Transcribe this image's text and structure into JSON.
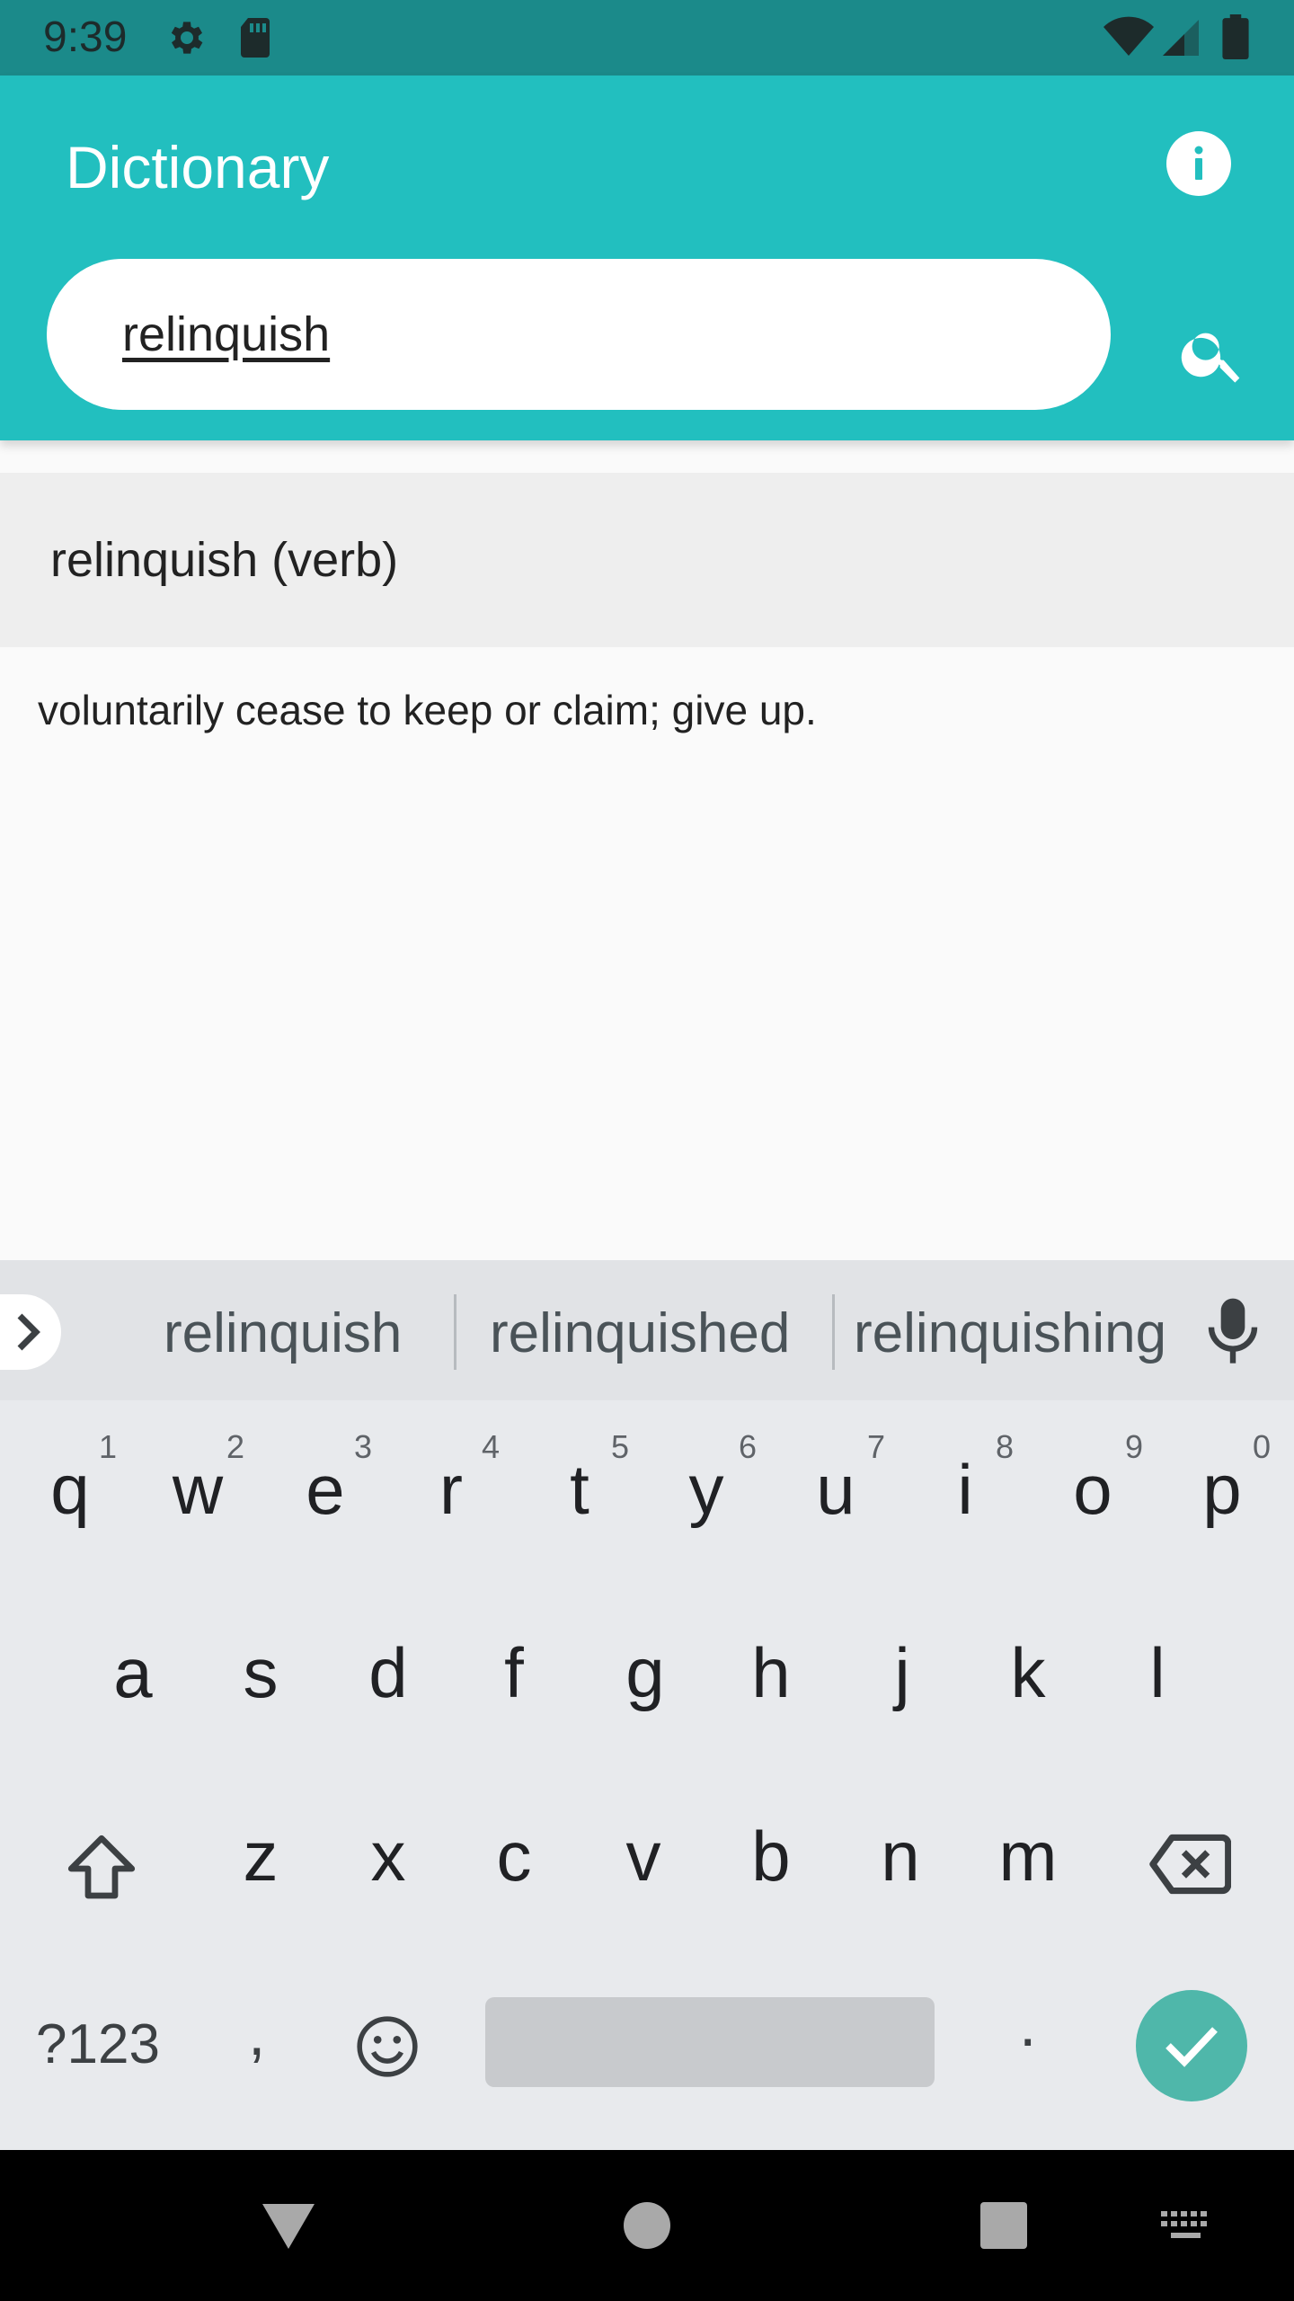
{
  "status_bar": {
    "time": "9:39",
    "icons": [
      "gear-icon",
      "sd-card-icon",
      "wifi-icon",
      "signal-icon",
      "battery-icon"
    ]
  },
  "app_bar": {
    "title": "Dictionary",
    "info_icon": "info-icon",
    "search_value": "relinquish",
    "search_icon": "search-icon"
  },
  "result": {
    "word": "relinquish (verb)",
    "definition": "voluntarily cease to keep or claim; give up."
  },
  "keyboard": {
    "suggestions": [
      "relinquish",
      "relinquished",
      "relinquishing"
    ],
    "row1": [
      "q",
      "w",
      "e",
      "r",
      "t",
      "y",
      "u",
      "i",
      "o",
      "p"
    ],
    "row1_hints": [
      "1",
      "2",
      "3",
      "4",
      "5",
      "6",
      "7",
      "8",
      "9",
      "0"
    ],
    "row2": [
      "a",
      "s",
      "d",
      "f",
      "g",
      "h",
      "j",
      "k",
      "l"
    ],
    "row3": [
      "z",
      "x",
      "c",
      "v",
      "b",
      "n",
      "m"
    ],
    "symbols_label": "?123",
    "comma_label": ",",
    "period_label": "."
  },
  "colors": {
    "accent": "#22bfbf",
    "status_bar": "#1b8a8a",
    "enter_key": "#4fb7aa"
  }
}
